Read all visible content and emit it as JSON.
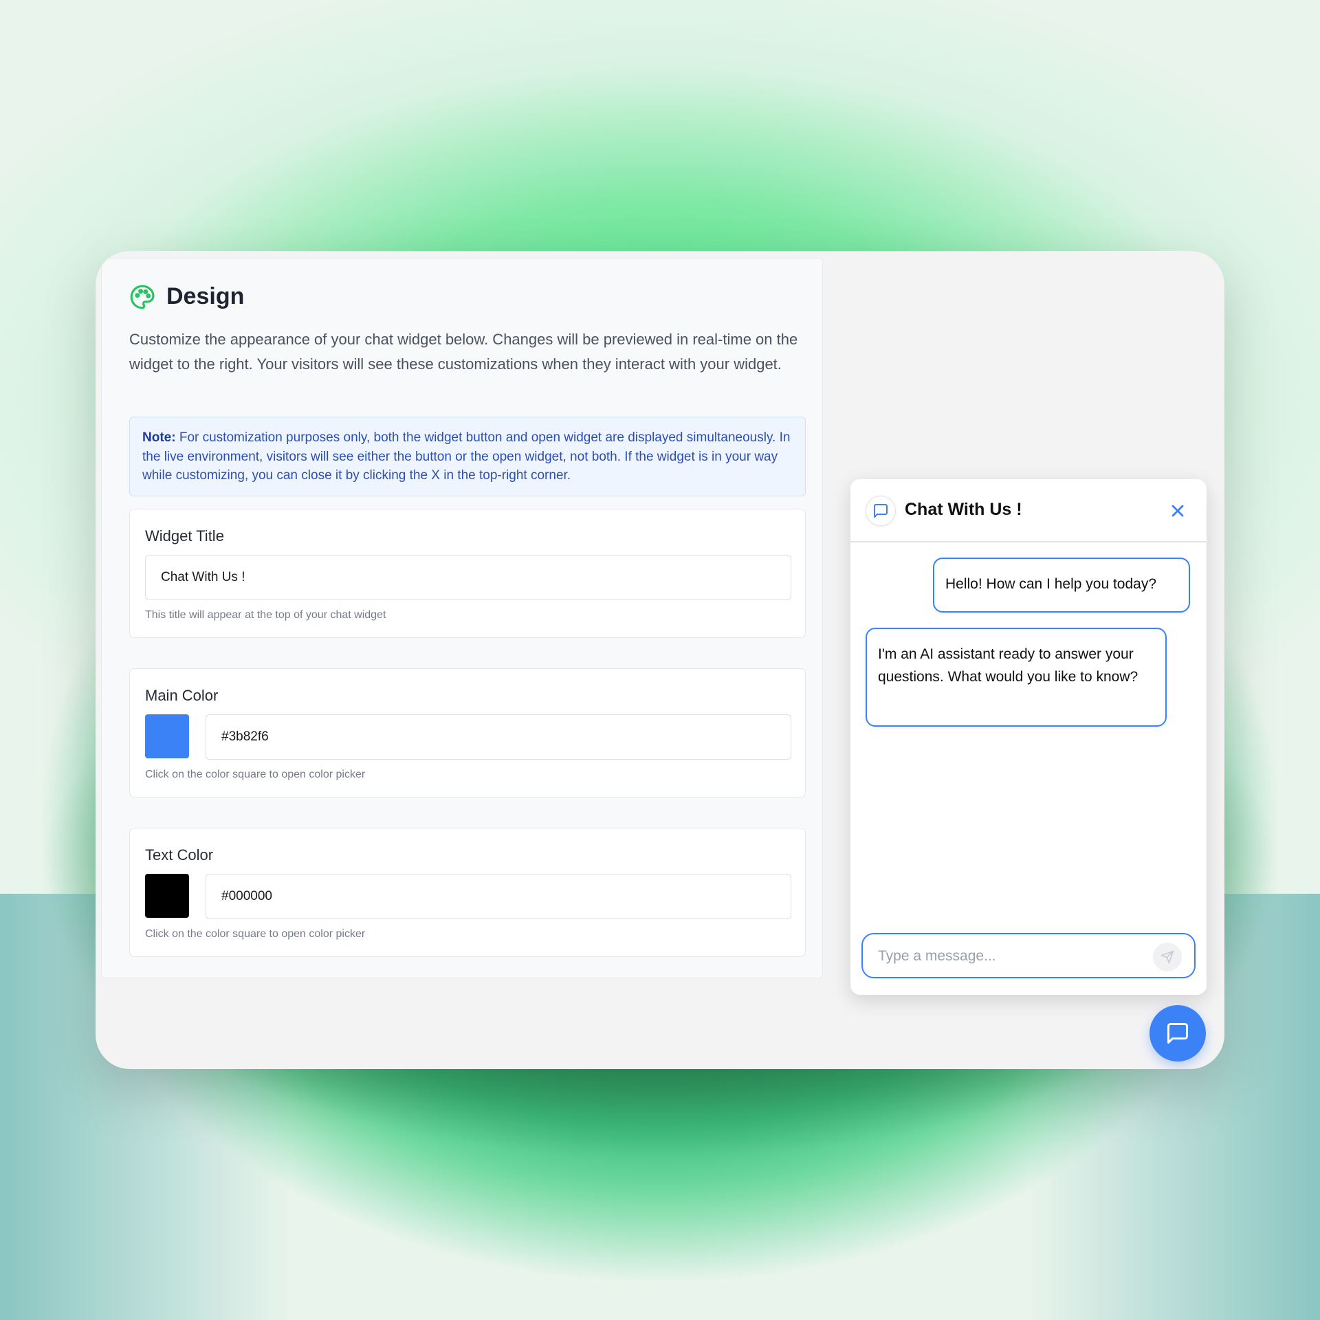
{
  "design": {
    "title": "Design",
    "description": "Customize the appearance of your chat widget below. Changes will be previewed in real-time on the widget to the right. Your visitors will see these customizations when they interact with your widget.",
    "note_label": "Note:",
    "note_text": " For customization purposes only, both the widget button and open widget are displayed simultaneously. In the live environment, visitors will see either the button or the open widget, not both. If the widget is in your way while customizing, you can close it by clicking the X in the top-right corner."
  },
  "widget_title_card": {
    "label": "Widget Title",
    "value": "Chat With Us !",
    "help": "This title will appear at the top of your chat widget"
  },
  "main_color_card": {
    "label": "Main Color",
    "value": "#3b82f6",
    "swatch": "#3b82f6",
    "help": "Click on the color square to open color picker"
  },
  "text_color_card": {
    "label": "Text Color",
    "value": "#000000",
    "swatch": "#000000",
    "help": "Click on the color square to open color picker"
  },
  "widget": {
    "title": "Chat With Us !",
    "messages": [
      "Hello! How can I help you today?",
      "I'm an AI assistant ready to answer your questions. What would you like to know?"
    ],
    "input_placeholder": "Type a message...",
    "accent": "#3b82f6"
  },
  "icons": {
    "header": "palette-icon",
    "avatar": "chat-bubble-icon",
    "close": "close-icon",
    "send": "send-icon",
    "fab": "chat-bubble-icon"
  },
  "colors": {
    "brand_green": "#22c55e",
    "accent_blue": "#3b82f6",
    "note_bg": "#eef5ff",
    "note_text": "#2d4eb1"
  }
}
